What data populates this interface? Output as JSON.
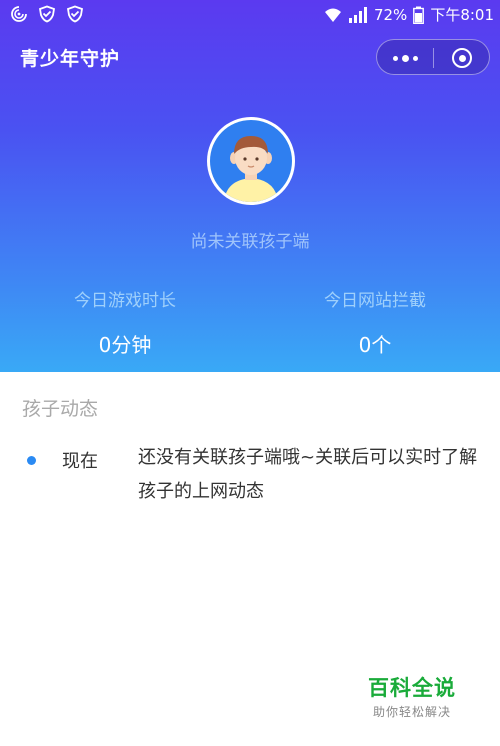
{
  "statusbar": {
    "battery_pct": "72%",
    "time": "下午8:01"
  },
  "header": {
    "title": "青少年守护"
  },
  "profile": {
    "status": "尚未关联孩子端"
  },
  "stats": [
    {
      "label": "今日游戏时长",
      "value": "0分钟"
    },
    {
      "label": "今日网站拦截",
      "value": "0个"
    }
  ],
  "activity": {
    "section_title": "孩子动态",
    "items": [
      {
        "time": "现在",
        "text": "还没有关联孩子端哦~关联后可以实时了解孩子的上网动态"
      }
    ]
  },
  "watermark": {
    "title": "百科全说",
    "subtitle": "助你轻松解决"
  },
  "colors": {
    "header_top": "#5b3af0",
    "header_bottom": "#39a9f6",
    "accent_dot": "#2a8af3",
    "watermark_green": "#1aab3a"
  }
}
